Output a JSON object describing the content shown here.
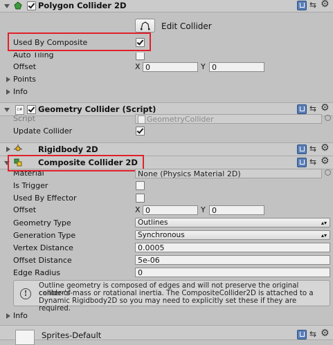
{
  "colors": {
    "highlight_red": "#e0202a",
    "bg": "#c2c2c2",
    "header_bg": "#cbcbcb"
  },
  "polygon_collider": {
    "title": "Polygon Collider 2D",
    "icon": "polygon-collider-icon",
    "edit_collider_label": "Edit Collider",
    "used_by_composite_label": "Used By Composite",
    "used_by_composite_checked": true,
    "auto_tiling_label": "Auto Tiling",
    "auto_tiling_checked": false,
    "offset_label": "Offset",
    "offset_x_label": "X",
    "offset_x": "0",
    "offset_y_label": "Y",
    "offset_y": "0",
    "points_label": "Points",
    "info_label": "Info"
  },
  "geometry_collider": {
    "title": "Geometry Collider (Script)",
    "script_label": "Script",
    "script_value": "GeometryCollider",
    "update_collider_label": "Update Collider",
    "update_collider_checked": true
  },
  "rigidbody": {
    "title": "Rigidbody 2D"
  },
  "composite_collider": {
    "title": "Composite Collider 2D",
    "material_label": "Material",
    "material_value": "None (Physics Material 2D)",
    "is_trigger_label": "Is Trigger",
    "used_by_effector_label": "Used By Effector",
    "offset_label": "Offset",
    "offset_x_label": "X",
    "offset_x": "0",
    "offset_y_label": "Y",
    "offset_y": "0",
    "geometry_type_label": "Geometry Type",
    "geometry_type_value": "Outlines",
    "generation_type_label": "Generation Type",
    "generation_type_value": "Synchronous",
    "vertex_distance_label": "Vertex Distance",
    "vertex_distance_value": "0.0005",
    "offset_distance_label": "Offset Distance",
    "offset_distance_value": "5e-06",
    "edge_radius_label": "Edge Radius",
    "edge_radius_value": "0",
    "help_line1": "Outline geometry is composed of edges and will not preserve the original collider's",
    "help_line2": "center-of-mass or rotational inertia.  The CompositeCollider2D is attached to a",
    "help_line3": "Dynamic Rigidbody2D so you may need to explicitly set these if they are required.",
    "info_label": "Info"
  },
  "sprites_default": {
    "title": "Sprites-Default"
  }
}
